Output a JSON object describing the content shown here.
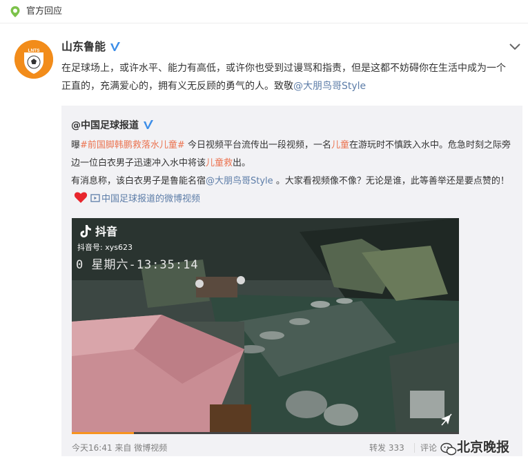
{
  "header": {
    "label": "官方回应",
    "icon": "location-pin-icon"
  },
  "post": {
    "author": "山东鲁能",
    "text_before": "在足球场上，或许水平、能力有高低，或许你也受到过谩骂和指责，但是这都不妨碍你在生活中成为一个正直的，充满爱心的，拥有义无反顾的勇气的人。致敬",
    "mention": "@大朋鸟哥Style"
  },
  "repost": {
    "author": "@中国足球报道",
    "p1_prefix": "曝",
    "p1_topic": "#前国脚韩鹏救落水儿童#",
    "p1_part1": "今日视频平台流传出一段视频，一名",
    "p1_kw1": "儿童",
    "p1_part2": "在游玩时不慎跌入水中。危急时刻之际旁边一位白衣男子迅速冲入水中将该",
    "p1_kw2": "儿童救",
    "p1_part3": "出。",
    "p2_part1": "有消息称，该白衣男子是鲁能名宿",
    "p2_mention": "@大朋鸟哥Style",
    "p2_part2": "。大家看视频像不像？无论是谁，此等善举还是要点赞的！",
    "video_link": "中国足球报道的微博视频"
  },
  "video": {
    "app_name": "抖音",
    "account_id": "抖音号: xys623",
    "overlay_time": "0 星期六-13:35:14",
    "progress_percent": 16,
    "colors": {
      "progress": "#f7931e"
    }
  },
  "footer": {
    "time_source": "今天16:41 来自 微博视频",
    "reposts": "转发 333",
    "comments": "评论"
  },
  "watermark": {
    "text": "北京晚报"
  },
  "colors": {
    "accent": "#eb7350",
    "link": "#5d7da8",
    "verified": "#3d8ee8"
  }
}
